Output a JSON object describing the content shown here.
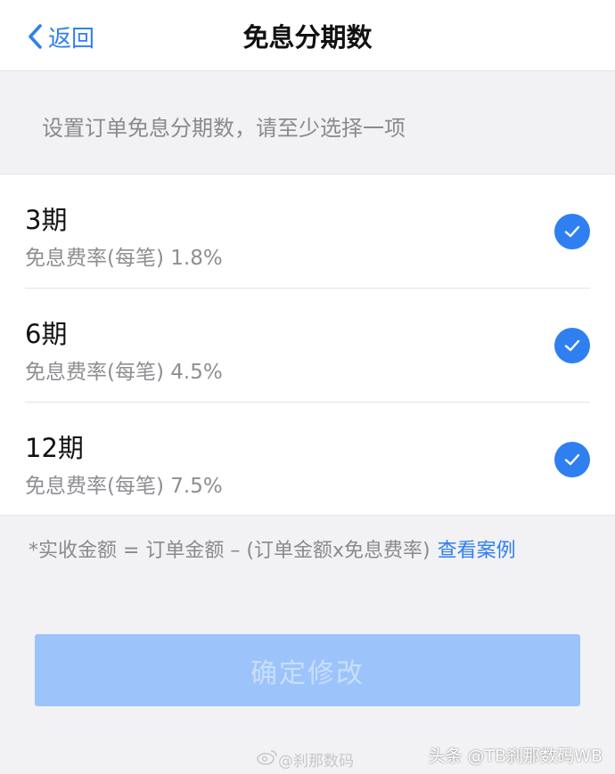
{
  "navbar": {
    "back_label": "返回",
    "title": "免息分期数"
  },
  "hint": "设置订单免息分期数，请至少选择一项",
  "options": [
    {
      "title": "3期",
      "rate": "免息费率(每笔) 1.8%",
      "checked": true
    },
    {
      "title": "6期",
      "rate": "免息费率(每笔) 4.5%",
      "checked": true
    },
    {
      "title": "12期",
      "rate": "免息费率(每笔) 7.5%",
      "checked": true
    }
  ],
  "formula": {
    "text": "*实收金额 = 订单金额 – (订单金额x免息费率)",
    "link": "查看案例"
  },
  "confirm_label": "确定修改",
  "watermarks": {
    "center": "@刹那数码",
    "corner": "头条 @TB刹那数码WB"
  },
  "colors": {
    "accent": "#2f7ff0",
    "button_disabled": "#9cc4fb",
    "background": "#f2f2f4"
  }
}
